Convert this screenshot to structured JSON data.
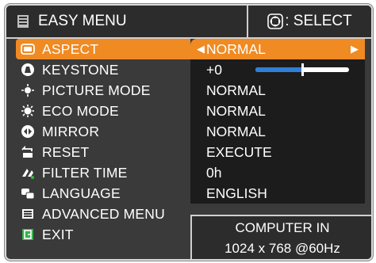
{
  "header": {
    "title": "EASY MENU",
    "select_hint": ": SELECT",
    "title_icon": "menu-icon",
    "select_icon": "dpad-icon"
  },
  "menu": {
    "items": [
      {
        "label": "ASPECT",
        "value": "NORMAL",
        "icon": "aspect-icon",
        "selected": true
      },
      {
        "label": "KEYSTONE",
        "value": "+0",
        "icon": "keystone-icon",
        "slider": 0.5
      },
      {
        "label": "PICTURE MODE",
        "value": "NORMAL",
        "icon": "picture-mode-icon"
      },
      {
        "label": "ECO MODE",
        "value": "NORMAL",
        "icon": "eco-mode-icon"
      },
      {
        "label": "MIRROR",
        "value": "NORMAL",
        "icon": "mirror-icon"
      },
      {
        "label": "RESET",
        "value": "EXECUTE",
        "icon": "reset-icon"
      },
      {
        "label": "FILTER TIME",
        "value": "0h",
        "icon": "filter-time-icon"
      },
      {
        "label": "LANGUAGE",
        "value": "ENGLISH",
        "icon": "language-icon"
      },
      {
        "label": "ADVANCED MENU",
        "value": "",
        "icon": "advanced-menu-icon"
      },
      {
        "label": "EXIT",
        "value": "",
        "icon": "exit-icon"
      }
    ]
  },
  "info": {
    "source": "COMPUTER IN",
    "signal": "1024 x 768 @60Hz"
  },
  "colors": {
    "highlight": "#f08a22",
    "slider_fill": "#2f7fd6",
    "panel": "#3a3a3a",
    "value_panel": "#1c1c1c"
  }
}
